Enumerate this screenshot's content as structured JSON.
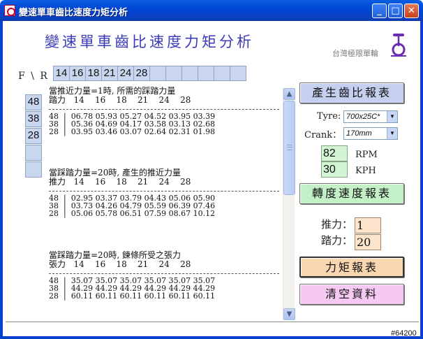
{
  "window": {
    "title": "變速單車齒比速度力矩分析",
    "minimize": "_",
    "maximize": "□",
    "close": "✕"
  },
  "header": {
    "title": "變速單車齒比速度力矩分析",
    "club": "台灣極限單輪",
    "logo_icon": "unicycle-icon"
  },
  "gears": {
    "fr_label": "F \\ R",
    "rear": [
      "14",
      "16",
      "18",
      "21",
      "24",
      "28",
      "",
      "",
      "",
      "",
      "",
      ""
    ],
    "front": [
      "48",
      "38",
      "28",
      "",
      ""
    ]
  },
  "report": {
    "sections": [
      {
        "title": "當推近力量=1時, 所需的踩踏力量",
        "head": "踏力   14    16    18    21    24    28",
        "rows": [
          "48  |  06.78 05.93 05.27 04.52 03.95 03.39",
          "38  |  05.36 04.69 04.17 03.58 03.13 02.68",
          "28  |  03.95 03.46 03.07 02.64 02.31 01.98"
        ]
      },
      {
        "title": "當踩踏力量=20時, 產生的推近力量",
        "head": "推力   14    16    18    21    24    28",
        "rows": [
          "48  |  02.95 03.37 03.79 04.43 05.06 05.90",
          "38  |  03.73 04.26 04.79 05.59 06.39 07.46",
          "28  |  05.06 05.78 06.51 07.59 08.67 10.12"
        ]
      },
      {
        "title": "當踩踏力量=20時, 鍊條所受之張力",
        "head": "張力   14    16    18    21    24    28",
        "rows": [
          "48  |  35.07 35.07 35.07 35.07 35.07 35.07",
          "38  |  44.29 44.29 44.29 44.29 44.29 44.29",
          "28  |  60.11 60.11 60.11 60.11 60.11 60.11"
        ]
      }
    ]
  },
  "controls": {
    "gear_report_button": "產生齒比報表",
    "tyre_label": "Tyre:",
    "tyre_value": "700x25C*",
    "crank_label": "Crank：",
    "crank_value": "170mm",
    "rpm_value": "82",
    "rpm_label": "RPM",
    "kph_value": "30",
    "kph_label": "KPH",
    "speed_report_button": "轉度速度報表",
    "thrust_label": "推力：",
    "thrust_value": "1",
    "pedal_label": "踏力：",
    "pedal_value": "20",
    "torque_report_button": "力矩報表",
    "clear_button": "清空資料"
  },
  "status": {
    "id": "#64200"
  }
}
